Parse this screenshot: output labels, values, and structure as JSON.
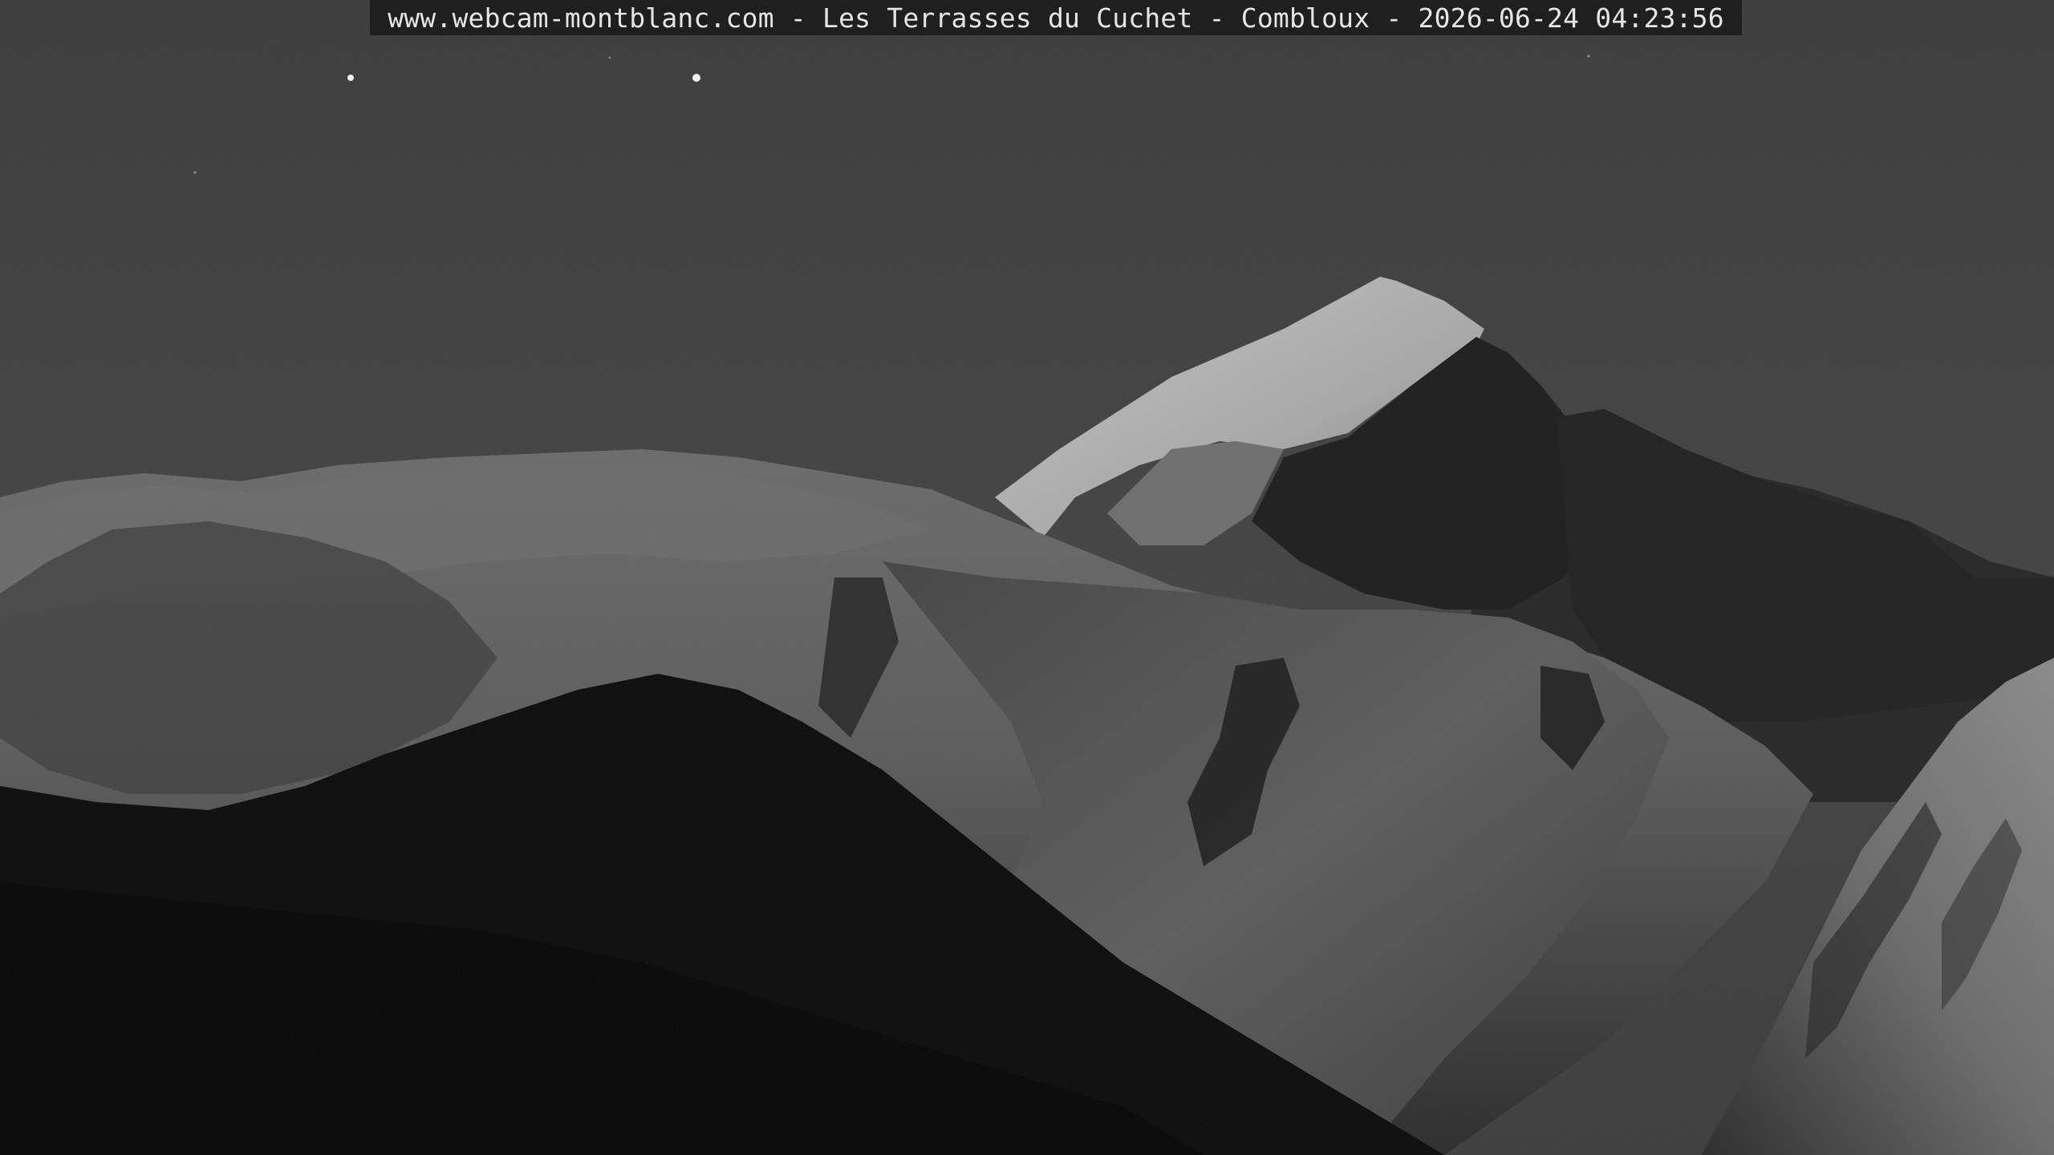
{
  "overlay": {
    "caption": "www.webcam-montblanc.com - Les Terrasses du Cuchet - Combloux - 2026-06-24 04:23:56"
  },
  "palette": {
    "sky": "#3f3f3f",
    "snow_lit": "#bdbdbd",
    "snow_mid": "#6e6e6e",
    "rock_shadow": "#1c1c1c",
    "foreground": "#070707",
    "caption_bg": "#1f1f1f",
    "caption_text": "#e6e6e6"
  }
}
